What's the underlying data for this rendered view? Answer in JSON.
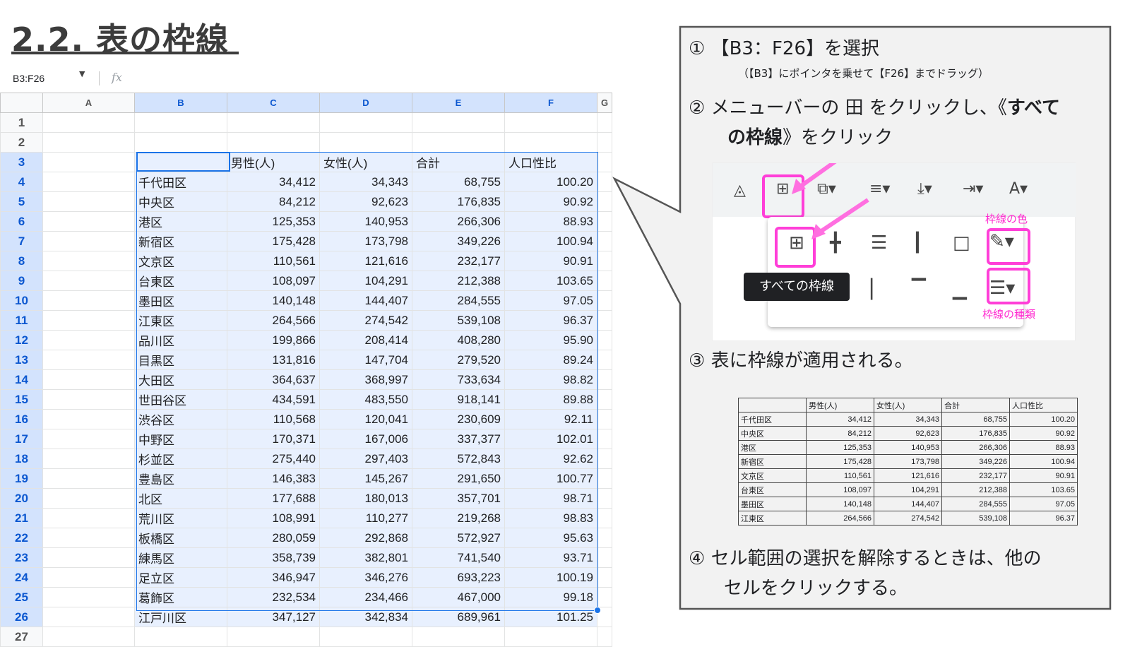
{
  "title": "2.2. 表の枠線",
  "namebox": "B3:F26",
  "fx": "fx",
  "columns": [
    "A",
    "B",
    "C",
    "D",
    "E",
    "F",
    "G"
  ],
  "rows": [
    "1",
    "2",
    "3",
    "4",
    "5",
    "6",
    "7",
    "8",
    "9",
    "10",
    "11",
    "12",
    "13",
    "14",
    "15",
    "16",
    "17",
    "18",
    "19",
    "20",
    "21",
    "22",
    "23",
    "24",
    "25",
    "26",
    "27"
  ],
  "table_header": [
    "",
    "男性(人)",
    "女性(人)",
    "合計",
    "人口性比"
  ],
  "table_rows": [
    [
      "千代田区",
      "34,412",
      "34,343",
      "68,755",
      "100.20"
    ],
    [
      "中央区",
      "84,212",
      "92,623",
      "176,835",
      "90.92"
    ],
    [
      "港区",
      "125,353",
      "140,953",
      "266,306",
      "88.93"
    ],
    [
      "新宿区",
      "175,428",
      "173,798",
      "349,226",
      "100.94"
    ],
    [
      "文京区",
      "110,561",
      "121,616",
      "232,177",
      "90.91"
    ],
    [
      "台東区",
      "108,097",
      "104,291",
      "212,388",
      "103.65"
    ],
    [
      "墨田区",
      "140,148",
      "144,407",
      "284,555",
      "97.05"
    ],
    [
      "江東区",
      "264,566",
      "274,542",
      "539,108",
      "96.37"
    ],
    [
      "品川区",
      "199,866",
      "208,414",
      "408,280",
      "95.90"
    ],
    [
      "目黒区",
      "131,816",
      "147,704",
      "279,520",
      "89.24"
    ],
    [
      "大田区",
      "364,637",
      "368,997",
      "733,634",
      "98.82"
    ],
    [
      "世田谷区",
      "434,591",
      "483,550",
      "918,141",
      "89.88"
    ],
    [
      "渋谷区",
      "110,568",
      "120,041",
      "230,609",
      "92.11"
    ],
    [
      "中野区",
      "170,371",
      "167,006",
      "337,377",
      "102.01"
    ],
    [
      "杉並区",
      "275,440",
      "297,403",
      "572,843",
      "92.62"
    ],
    [
      "豊島区",
      "146,383",
      "145,267",
      "291,650",
      "100.77"
    ],
    [
      "北区",
      "177,688",
      "180,013",
      "357,701",
      "98.71"
    ],
    [
      "荒川区",
      "108,991",
      "110,277",
      "219,268",
      "98.83"
    ],
    [
      "板橋区",
      "280,059",
      "292,868",
      "572,927",
      "95.63"
    ],
    [
      "練馬区",
      "358,739",
      "382,801",
      "741,540",
      "93.71"
    ],
    [
      "足立区",
      "346,947",
      "346,276",
      "693,223",
      "100.19"
    ],
    [
      "葛飾区",
      "232,534",
      "234,466",
      "467,000",
      "99.18"
    ],
    [
      "江戸川区",
      "347,127",
      "342,834",
      "689,961",
      "101.25"
    ]
  ],
  "callout": {
    "step1": "① 【B3：F26】を選択",
    "step1_sub": "（【B3】にポインタを乗せて【F26】までドラッグ）",
    "step2_a": "② メニューバーの 田 をクリックし、《",
    "step2_b": "すべて",
    "step2_c": "の枠線",
    "step2_d": "》をクリック",
    "tooltip": "すべての枠線",
    "label_color": "枠線の色",
    "label_style": "枠線の種類",
    "step3": "③ 表に枠線が適用される。",
    "step4_a": "④ セル範囲の選択を解除するときは、他の",
    "step4_b": "セルをクリックする。"
  },
  "colors": {
    "accent_blue": "#1a73e8",
    "selection_fill": "#e8f0fe",
    "pink": "#ff3fd8"
  },
  "icons": [
    "paint-bucket-icon",
    "borders-icon",
    "merge-icon",
    "align-icon",
    "valign-icon",
    "text-rotate-icon",
    "text-color-icon",
    "pen-icon",
    "border-style-icon"
  ]
}
